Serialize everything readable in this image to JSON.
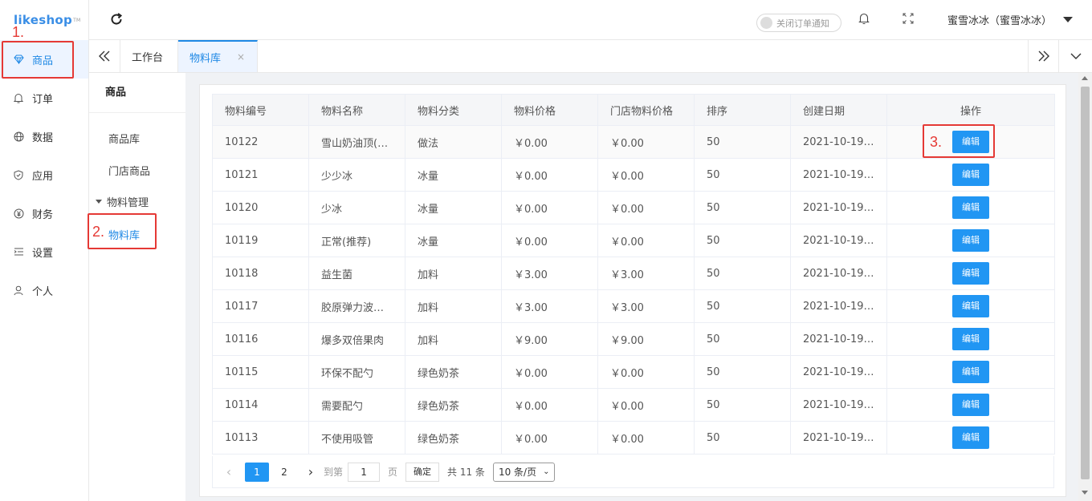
{
  "logo": {
    "text": "likeshop",
    "tm": "TM"
  },
  "sidebar": {
    "items": [
      {
        "label": "商品",
        "icon": "diamond-icon"
      },
      {
        "label": "订单",
        "icon": "bell-icon"
      },
      {
        "label": "数据",
        "icon": "globe-icon"
      },
      {
        "label": "应用",
        "icon": "shield-icon"
      },
      {
        "label": "财务",
        "icon": "yen-icon"
      },
      {
        "label": "设置",
        "icon": "settings-list-icon"
      },
      {
        "label": "个人",
        "icon": "user-icon"
      }
    ]
  },
  "header": {
    "notice_toggle": "关闭订单通知",
    "user": "蜜雪冰冰（蜜雪冰冰）"
  },
  "tabs": {
    "workbench": "工作台",
    "material": "物料库",
    "close": "×"
  },
  "subnav": {
    "title": "商品",
    "items": {
      "library": "商品库",
      "store_goods": "门店商品",
      "group": "物料管理",
      "material": "物料库"
    }
  },
  "table": {
    "columns": [
      "物料编号",
      "物料名称",
      "物料分类",
      "物料价格",
      "门店物料价格",
      "排序",
      "创建日期",
      "操作"
    ],
    "edit_label": "编辑",
    "rows": [
      [
        "10122",
        "雪山奶油顶(…",
        "做法",
        "￥0.00",
        "￥0.00",
        "50",
        "2021-10-19…"
      ],
      [
        "10121",
        "少少冰",
        "冰量",
        "￥0.00",
        "￥0.00",
        "50",
        "2021-10-19…"
      ],
      [
        "10120",
        "少冰",
        "冰量",
        "￥0.00",
        "￥0.00",
        "50",
        "2021-10-19…"
      ],
      [
        "10119",
        "正常(推荐)",
        "冰量",
        "￥0.00",
        "￥0.00",
        "50",
        "2021-10-19…"
      ],
      [
        "10118",
        "益生菌",
        "加料",
        "￥3.00",
        "￥3.00",
        "50",
        "2021-10-19…"
      ],
      [
        "10117",
        "胶原弹力波…",
        "加料",
        "￥3.00",
        "￥3.00",
        "50",
        "2021-10-19…"
      ],
      [
        "10116",
        "爆多双倍果肉",
        "加料",
        "￥9.00",
        "￥9.00",
        "50",
        "2021-10-19…"
      ],
      [
        "10115",
        "环保不配勺",
        "绿色奶茶",
        "￥0.00",
        "￥0.00",
        "50",
        "2021-10-19…"
      ],
      [
        "10114",
        "需要配勺",
        "绿色奶茶",
        "￥0.00",
        "￥0.00",
        "50",
        "2021-10-19…"
      ],
      [
        "10113",
        "不使用吸管",
        "绿色奶茶",
        "￥0.00",
        "￥0.00",
        "50",
        "2021-10-19…"
      ]
    ]
  },
  "pagination": {
    "prev": "‹",
    "pages": [
      "1",
      "2"
    ],
    "next": "›",
    "goto_label": "到第",
    "goto_value": "1",
    "page_unit": "页",
    "confirm": "确定",
    "total": "共 11 条",
    "page_size": "10 条/页"
  },
  "annotations": {
    "a1": "1.",
    "a2": "2.",
    "a3": "3."
  },
  "colors": {
    "accent": "#2196f3",
    "annotation": "#e53935"
  }
}
